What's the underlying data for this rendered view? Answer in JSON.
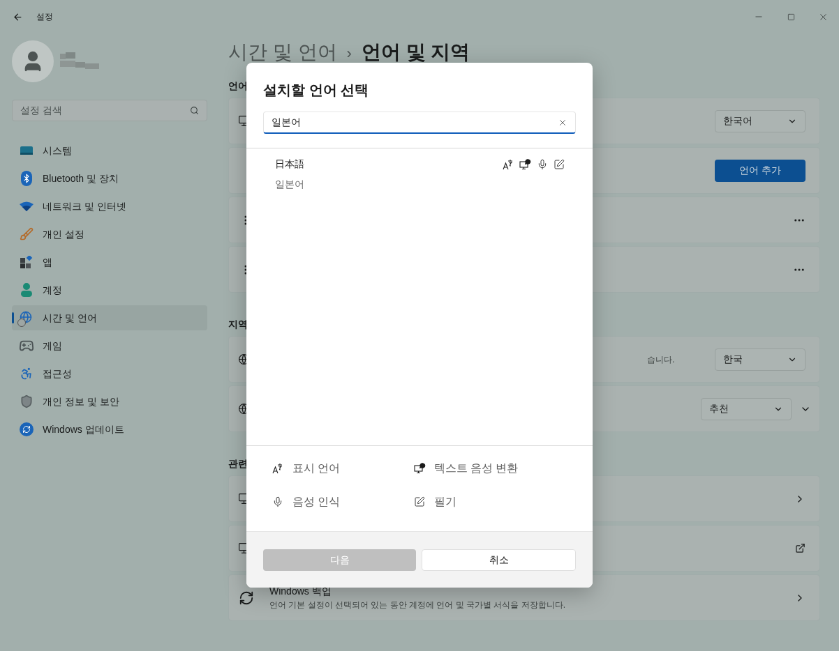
{
  "window": {
    "title": "설정"
  },
  "sidebar": {
    "search": {
      "placeholder": "설정 검색"
    },
    "items": [
      {
        "label": "시스템",
        "selected": false
      },
      {
        "label": "Bluetooth 및 장치",
        "selected": false
      },
      {
        "label": "네트워크 및 인터넷",
        "selected": false
      },
      {
        "label": "개인 설정",
        "selected": false
      },
      {
        "label": "앱",
        "selected": false
      },
      {
        "label": "계정",
        "selected": false
      },
      {
        "label": "시간 및 언어",
        "selected": true
      },
      {
        "label": "게임",
        "selected": false
      },
      {
        "label": "접근성",
        "selected": false
      },
      {
        "label": "개인 정보 및 보안",
        "selected": false
      },
      {
        "label": "Windows 업데이트",
        "selected": false
      }
    ]
  },
  "breadcrumb": {
    "parent": "시간 및 언어",
    "separator": "›",
    "current": "언어 및 지역"
  },
  "sections": [
    {
      "heading": "언어",
      "cards": [
        {
          "kind": "dropdown",
          "value": "한국어"
        },
        {
          "kind": "button",
          "button": "언어 추가"
        },
        {
          "kind": "menu"
        },
        {
          "kind": "menu"
        }
      ]
    },
    {
      "heading": "지역",
      "cards": [
        {
          "kind": "dropdown",
          "description": "습니다.",
          "value": "한국"
        },
        {
          "kind": "dropdown",
          "value": "추천",
          "expanded": false
        }
      ]
    },
    {
      "heading": "관련",
      "cards": [
        {
          "kind": "link"
        },
        {
          "kind": "external"
        },
        {
          "kind": "link",
          "title": "Windows 백업",
          "description": "언어 기본 설정이 선택되어 있는 동안 계정에 언어 및 국가별 서식을 저장합니다."
        }
      ]
    }
  ],
  "dialog": {
    "title": "설치할 언어 선택",
    "search": {
      "value": "일본어"
    },
    "results": [
      {
        "name": "日本語",
        "subtitle": "일본어",
        "selected": false,
        "features": {
          "display_language": true,
          "text_to_speech": true,
          "speech_recognition": true,
          "handwriting": true
        }
      }
    ],
    "legend": [
      "표시 언어",
      "텍스트 음성 변환",
      "음성 인식",
      "필기"
    ],
    "buttons": [
      {
        "label": "다음",
        "disabled": true
      },
      {
        "label": "취소",
        "disabled": false
      }
    ]
  }
}
